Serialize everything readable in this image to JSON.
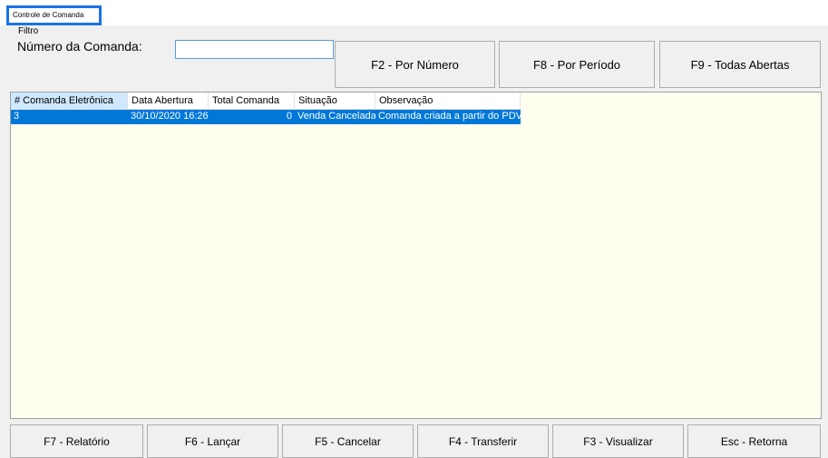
{
  "tab": {
    "label": "Controle de Comanda"
  },
  "filter": {
    "legend": "Filtro",
    "numero_label": "Número da Comanda:",
    "numero_value": ""
  },
  "top_buttons": [
    {
      "label": "F2 - Por Número"
    },
    {
      "label": "F8 - Por Período"
    },
    {
      "label": "F9 - Todas Abertas"
    }
  ],
  "grid": {
    "columns": [
      {
        "label": "# Comanda Eletrônica"
      },
      {
        "label": "Data Abertura"
      },
      {
        "label": "Total Comanda"
      },
      {
        "label": "Situação"
      },
      {
        "label": "Observação"
      }
    ],
    "rows": [
      [
        "3",
        "30/10/2020 16:26",
        "0",
        "Venda Cancelada",
        "Comanda criada a partir do PDV"
      ]
    ]
  },
  "bottom_buttons": [
    {
      "label": "F7 - Relatório"
    },
    {
      "label": "F6 - Lançar"
    },
    {
      "label": "F5 - Cancelar"
    },
    {
      "label": "F4 - Transferir"
    },
    {
      "label": "F3 - Visualizar"
    },
    {
      "label": "Esc - Retorna"
    }
  ],
  "colors": {
    "selection": "#0078d7",
    "grid_background": "#fffff0",
    "tab_highlight": "#1a73e8"
  }
}
